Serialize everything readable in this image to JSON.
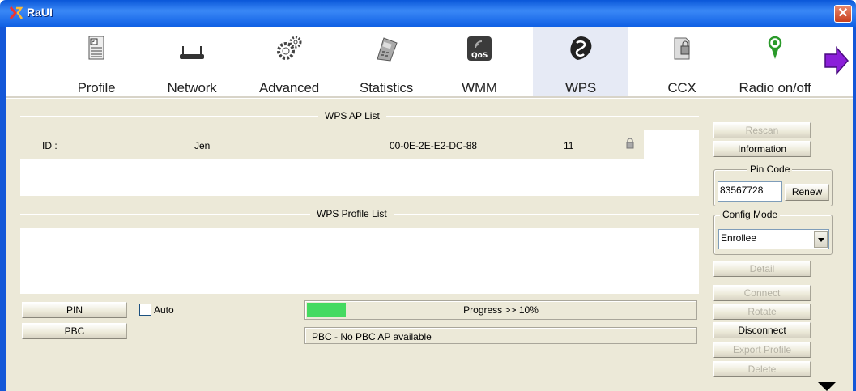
{
  "window": {
    "title": "RaUI",
    "close_glyph": "✕"
  },
  "toolbar": {
    "items": [
      {
        "label": "Profile",
        "icon": "profile-icon"
      },
      {
        "label": "Network",
        "icon": "network-icon"
      },
      {
        "label": "Advanced",
        "icon": "advanced-icon"
      },
      {
        "label": "Statistics",
        "icon": "statistics-icon"
      },
      {
        "label": "WMM",
        "icon": "qos-icon"
      },
      {
        "label": "WPS",
        "icon": "wps-icon",
        "active": true
      },
      {
        "label": "CCX",
        "icon": "ccx-icon"
      },
      {
        "label": "Radio on/off",
        "icon": "radio-icon"
      }
    ],
    "next_icon": "arrow-right-icon"
  },
  "wps_ap_list": {
    "title": "WPS AP List",
    "row": {
      "id_label": "ID :",
      "ssid": "Jen",
      "bssid": "00-0E-2E-E2-DC-88",
      "channel": "11",
      "lock_icon": "lock-icon"
    }
  },
  "wps_profile_list": {
    "title": "WPS Profile List"
  },
  "buttons": {
    "pin": "PIN",
    "pbc": "PBC",
    "rescan": "Rescan",
    "information": "Information",
    "renew": "Renew",
    "detail": "Detail",
    "connect": "Connect",
    "rotate": "Rotate",
    "disconnect": "Disconnect",
    "export_profile": "Export Profile",
    "delete": "Delete"
  },
  "auto_checkbox": {
    "label": "Auto",
    "checked": false
  },
  "progress": {
    "text": "Progress >> 10%",
    "value": 10
  },
  "status_text": "PBC - No PBC AP available",
  "pin_code": {
    "title": "Pin Code",
    "value": "83567728"
  },
  "config_mode": {
    "title": "Config Mode",
    "selected": "Enrollee"
  },
  "colors": {
    "titlebar": "#1660e4",
    "progress": "#45da61",
    "background": "#ece9d8"
  }
}
